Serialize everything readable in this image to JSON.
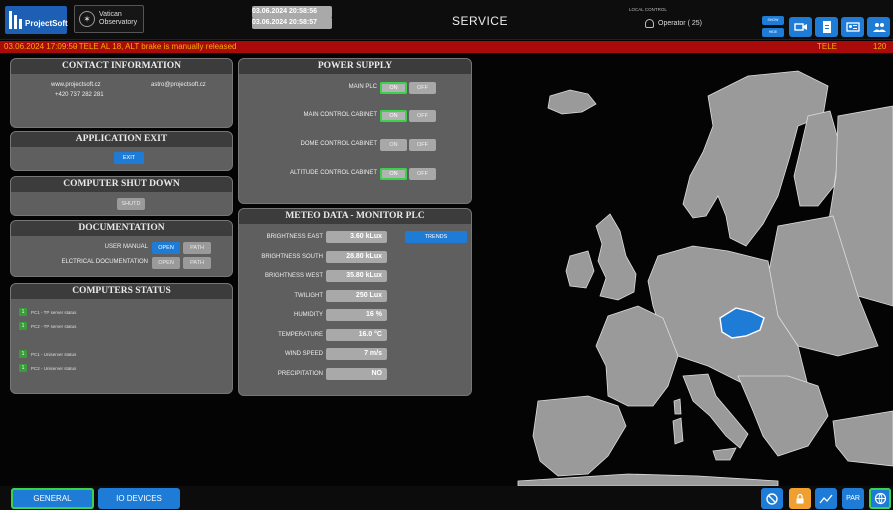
{
  "header": {
    "logo_text": "ProjectSoft",
    "vo_logo_line1": "Vatican",
    "vo_logo_line2": "Observatory",
    "server_time_label": "Server time (UTC)",
    "server_time": "03.06.2024 20:58:56",
    "client_time_label": "Client time",
    "client_time": "03.06.2024 20:58:57",
    "mode": "SERVICE",
    "local_control_label": "LOCAL CONTROL",
    "operator": "Operator ( 25)",
    "show_label": "SHOW",
    "hide_label": "HIDE",
    "icons": [
      "camera-icon",
      "document-icon",
      "id-card-icon",
      "users-icon"
    ]
  },
  "alarm": {
    "time": "03.06.2024 17:09:50",
    "message": "-   TELE AL 18, ALT brake is manually released",
    "source": "TELE",
    "number": "120"
  },
  "contact": {
    "title": "CONTACT INFORMATION",
    "website": "www.projectsoft.cz",
    "email": "astro@projectsoft.cz",
    "phone": "+420 737 282 281"
  },
  "app_exit": {
    "title": "APPLICATION EXIT",
    "button": "EXIT"
  },
  "shutdown": {
    "title": "COMPUTER SHUT DOWN",
    "button": "SHUTD"
  },
  "documentation": {
    "title": "DOCUMENTATION",
    "rows": [
      {
        "label": "USER MANUAL",
        "open": "OPEN",
        "path": "PATH"
      },
      {
        "label": "ELCTRICAL DOCUMENTATION",
        "open": "OPEN",
        "path": "PATH"
      }
    ]
  },
  "computers": {
    "title": "COMPUTERS STATUS",
    "items": [
      {
        "num": "1",
        "label": "PC1 - TP server status"
      },
      {
        "num": "1",
        "label": "PC2 - TP server status"
      },
      {
        "num": "1",
        "label": "PC1 - Uniserver status"
      },
      {
        "num": "1",
        "label": "PC2 - Uniserver status"
      }
    ]
  },
  "power": {
    "title": "POWER SUPPLY",
    "on": "ON",
    "off": "OFF",
    "rows": [
      "MAIN PLC",
      "MAIN CONTROL CABINET",
      "DOME CONTROL CABINET",
      "ALTITUDE CONTROL CABINET"
    ]
  },
  "meteo": {
    "title": "METEO DATA - MONITOR PLC",
    "trends": "TRENDS",
    "rows": [
      {
        "label": "BRIGHTNESS EAST",
        "value": "3.60 kLux"
      },
      {
        "label": "BRIGHTNESS SOUTH",
        "value": "28.80 kLux"
      },
      {
        "label": "BRIGHTNESS WEST",
        "value": "35.80 kLux"
      },
      {
        "label": "TWILIGHT",
        "value": "250 Lux"
      },
      {
        "label": "HUMIDITY",
        "value": "16 %"
      },
      {
        "label": "TEMPERATURE",
        "value": "16.0 °C"
      },
      {
        "label": "WIND SPEED",
        "value": "7 m/s"
      },
      {
        "label": "PRECIPITATION",
        "value": "NO"
      }
    ]
  },
  "bottom": {
    "general": "GENERAL",
    "io_devices": "IO DEVICES",
    "par": "PAR",
    "icons": [
      "no-entry-icon",
      "lock-icon",
      "trend-icon",
      "globe-icon"
    ]
  },
  "colors": {
    "accent": "#1e7bd6",
    "alarm_bg": "#a90a0a",
    "alarm_text": "#f0b000",
    "ok_green": "#3bd14b",
    "highlight_country": "#1e7bd6"
  }
}
